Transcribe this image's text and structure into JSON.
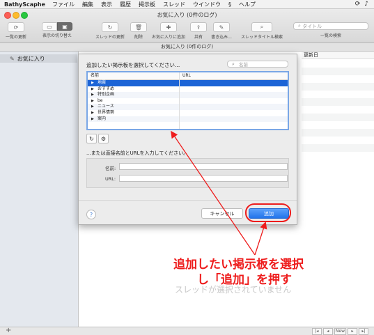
{
  "menubar": {
    "app": "BathyScaphe",
    "items": [
      "ファイル",
      "編集",
      "表示",
      "履歴",
      "掲示板",
      "スレッド",
      "ウインドウ",
      "ヘルプ"
    ]
  },
  "window": {
    "title": "お気に入り (0件のログ)",
    "path": "お気に入り (0件のログ)"
  },
  "toolbar": {
    "refresh_list": "一覧の更新",
    "toggle_view": "表示の切り替え",
    "thread_refresh": "スレッドの更新",
    "delete": "削除",
    "add_favorite": "お気に入りに追加",
    "share": "共有",
    "write": "書き込み...",
    "thread_title_search": "スレッドタイトル検索",
    "search_placeholder": "タイトル",
    "list_search": "一覧の検索"
  },
  "sidebar": {
    "favorites": "お気に入り"
  },
  "main": {
    "updated_col": "更新日",
    "empty_text": "スレッドが選択されていません"
  },
  "sheet": {
    "title": "追加したい掲示板を選択してください...",
    "search_placeholder": "名前",
    "col_name": "名前",
    "col_url": "URL",
    "boards": [
      "地震",
      "おすすめ",
      "特別企画",
      "be",
      "ニュース",
      "世界情勢",
      "案内"
    ],
    "subtitle": "...または直接名前とURLを入力してください。",
    "name_label": "名前:",
    "url_label": "URL:",
    "cancel": "キャンセル",
    "add": "追加"
  },
  "annotation": {
    "line1": "追加したい掲示板を選択",
    "line2": "し「追加」を押す",
    "color": "#ee1c1c"
  },
  "pager": {
    "new": "New"
  }
}
